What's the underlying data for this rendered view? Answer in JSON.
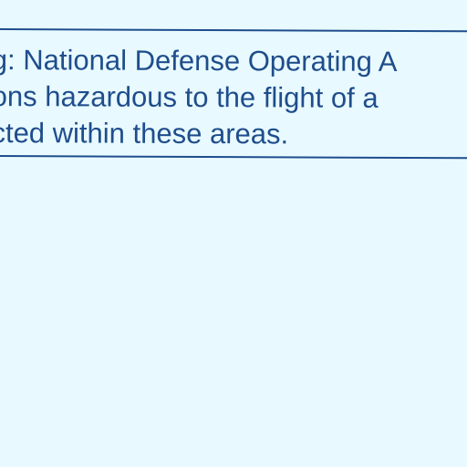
{
  "map": {
    "background_color": "#E8FAFF",
    "notice": {
      "text_color": "#1F4D8C",
      "border_color": "#1F4D8C",
      "lines": [
        "g: National Defense Operating A",
        "ons hazardous to the flight of a",
        "cted within these areas."
      ]
    }
  }
}
